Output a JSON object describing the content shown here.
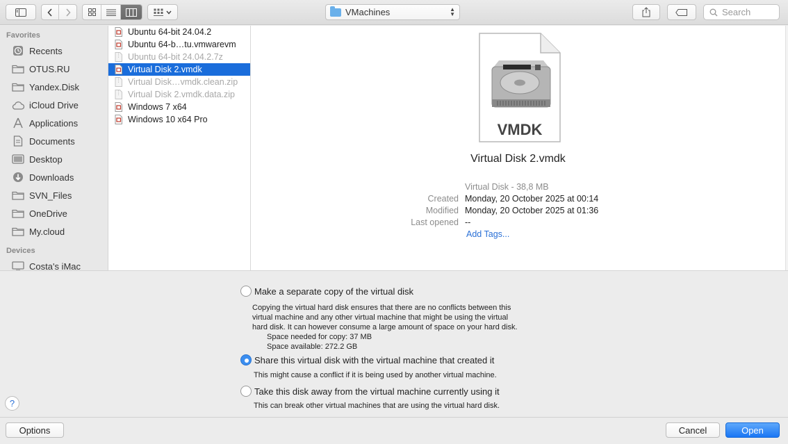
{
  "toolbar": {
    "location": "VMachines",
    "search_placeholder": "Search"
  },
  "sidebar": {
    "favorites_header": "Favorites",
    "favorites": [
      {
        "label": "Recents",
        "icon": "clock-icon"
      },
      {
        "label": "OTUS.RU",
        "icon": "folder-icon"
      },
      {
        "label": "Yandex.Disk",
        "icon": "folder-icon"
      },
      {
        "label": "iCloud Drive",
        "icon": "cloud-icon"
      },
      {
        "label": "Applications",
        "icon": "applications-icon"
      },
      {
        "label": "Documents",
        "icon": "document-icon"
      },
      {
        "label": "Desktop",
        "icon": "desktop-icon"
      },
      {
        "label": "Downloads",
        "icon": "download-icon"
      },
      {
        "label": "SVN_Files",
        "icon": "folder-icon"
      },
      {
        "label": "OneDrive",
        "icon": "folder-icon"
      },
      {
        "label": "My.cloud",
        "icon": "folder-icon"
      }
    ],
    "devices_header": "Devices",
    "devices": [
      {
        "label": "Costa's iMac",
        "icon": "computer-icon"
      }
    ]
  },
  "files": [
    {
      "name": "Ubuntu 64-bit 24.04.2",
      "state": "normal"
    },
    {
      "name": "Ubuntu 64-b…tu.vmwarevm",
      "state": "normal"
    },
    {
      "name": "Ubuntu 64-bit 24.04.2.7z",
      "state": "dim"
    },
    {
      "name": "Virtual Disk 2.vmdk",
      "state": "selected"
    },
    {
      "name": "Virtual Disk…vmdk.clean.zip",
      "state": "dim"
    },
    {
      "name": "Virtual Disk 2.vmdk.data.zip",
      "state": "dim"
    },
    {
      "name": "Windows 7 x64",
      "state": "normal"
    },
    {
      "name": "Windows 10 x64 Pro",
      "state": "normal"
    }
  ],
  "preview": {
    "icon_label": "VMDK",
    "file_name": "Virtual Disk 2.vmdk",
    "kind_size": "Virtual Disk - 38,8 MB",
    "created_label": "Created",
    "created": "Monday, 20 October 2025 at 00:14",
    "modified_label": "Modified",
    "modified": "Monday, 20 October 2025 at 01:36",
    "last_opened_label": "Last opened",
    "last_opened": "--",
    "add_tags": "Add Tags..."
  },
  "options": {
    "copy": {
      "label": "Make a separate copy of the virtual disk",
      "desc1": "Copying the virtual hard disk ensures that there are no conflicts between this",
      "desc2": "virtual machine and any other virtual machine that might be using the virtual",
      "desc3": "hard disk.  It can however consume a large amount of space on your hard disk.",
      "space_needed": "Space needed for copy: 37 MB",
      "space_available": "Space available: 272.2 GB",
      "selected": false
    },
    "share": {
      "label": "Share this virtual disk with the virtual machine that created it",
      "desc": "This might cause a conflict if it is being used by another virtual machine.",
      "selected": true
    },
    "take": {
      "label": "Take this disk away from the virtual machine currently using it",
      "desc": "This can break other virtual machines that are using the virtual hard disk.",
      "selected": false
    }
  },
  "buttons": {
    "help": "?",
    "options": "Options",
    "cancel": "Cancel",
    "open": "Open"
  },
  "colors": {
    "selection": "#1a6ddb",
    "accent": "#1a76f4",
    "link": "#2a70d6"
  }
}
